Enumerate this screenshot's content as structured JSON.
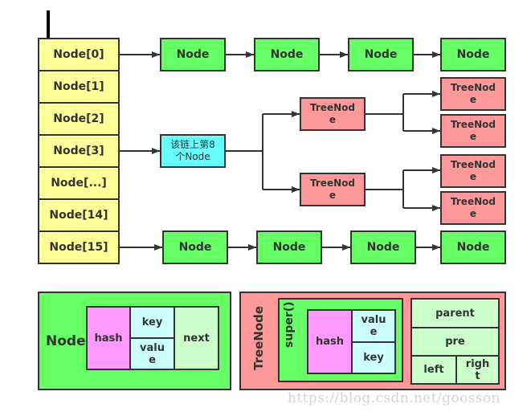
{
  "array": {
    "cells": [
      "Node[0]",
      "Node[1]",
      "Node[2]",
      "Node[3]",
      "Node[...]",
      "Node[14]",
      "Node[15]"
    ],
    "color": "#ffff99"
  },
  "top_chain": {
    "nodes": [
      "Node",
      "Node",
      "Node",
      "Node"
    ],
    "color": "#66ff66"
  },
  "bottom_chain": {
    "nodes": [
      "Node",
      "Node",
      "Node",
      "Node"
    ],
    "color": "#66ff66"
  },
  "tree": {
    "root_label_line1": "该链上第8",
    "root_label_line2": "个Node",
    "root_color": "#66ffff",
    "level1": [
      {
        "line1": "TreeNod",
        "line2": "e"
      },
      {
        "line1": "TreeNod",
        "line2": "e"
      }
    ],
    "level2": [
      {
        "line1": "TreeNod",
        "line2": "e"
      },
      {
        "line1": "TreeNod",
        "line2": "e"
      },
      {
        "line1": "TreeNod",
        "line2": "e"
      },
      {
        "line1": "TreeNod",
        "line2": "e"
      }
    ],
    "treenode_color": "#ff9999"
  },
  "node_legend": {
    "title": "Node",
    "hash": "hash",
    "key": "key",
    "value_line1": "valu",
    "value_line2": "e",
    "next": "next"
  },
  "treenode_legend": {
    "title": "TreeNode",
    "super_label": "super()",
    "hash": "hash",
    "value_line1": "valu",
    "value_line2": "e",
    "key": "key",
    "parent": "parent",
    "pre": "pre",
    "left": "left",
    "right_line1": "righ",
    "right_line2": "t"
  },
  "watermark": "https://blog.csdn.net/goosson"
}
